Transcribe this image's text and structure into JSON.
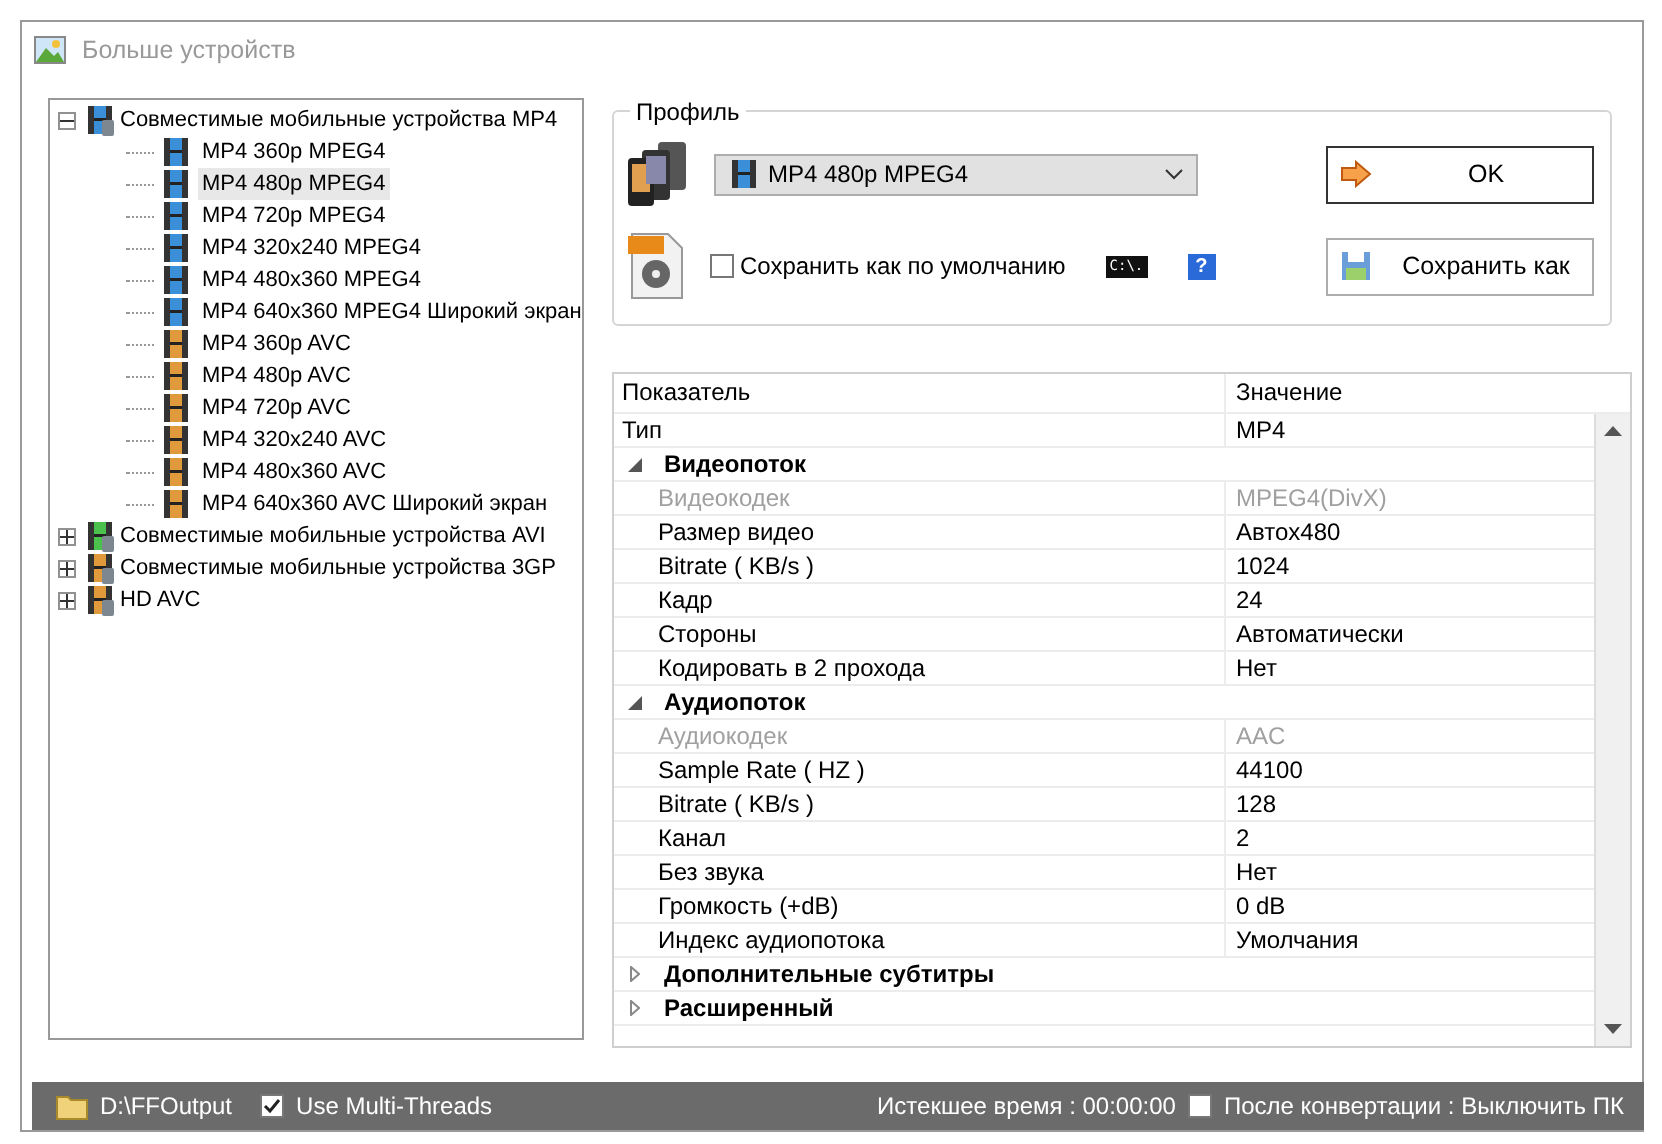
{
  "window": {
    "title": "Больше устройств"
  },
  "tree": [
    {
      "label": "Совместимые мобильные устройства MP4",
      "expanded": true,
      "color": "#3a8fd8",
      "selected": false,
      "children": [
        {
          "label": "MP4 360p MPEG4",
          "color": "#3a8fd8",
          "selected": false
        },
        {
          "label": "MP4 480p MPEG4",
          "color": "#3a8fd8",
          "selected": true
        },
        {
          "label": "MP4 720p MPEG4",
          "color": "#3a8fd8",
          "selected": false
        },
        {
          "label": "MP4 320x240 MPEG4",
          "color": "#3a8fd8",
          "selected": false
        },
        {
          "label": "MP4 480x360 MPEG4",
          "color": "#3a8fd8",
          "selected": false
        },
        {
          "label": "MP4 640x360 MPEG4 Широкий экран",
          "color": "#3a8fd8",
          "selected": false
        },
        {
          "label": "MP4 360p AVC",
          "color": "#e09a3c",
          "selected": false
        },
        {
          "label": "MP4 480p AVC",
          "color": "#e09a3c",
          "selected": false
        },
        {
          "label": "MP4 720p AVC",
          "color": "#e09a3c",
          "selected": false
        },
        {
          "label": "MP4 320x240 AVC",
          "color": "#e09a3c",
          "selected": false
        },
        {
          "label": "MP4 480x360 AVC",
          "color": "#e09a3c",
          "selected": false
        },
        {
          "label": "MP4 640x360 AVC Широкий экран",
          "color": "#e09a3c",
          "selected": false
        }
      ]
    },
    {
      "label": "Совместимые мобильные устройства AVI",
      "expanded": false,
      "color": "#4cc04c",
      "selected": false
    },
    {
      "label": "Совместимые мобильные устройства 3GP",
      "expanded": false,
      "color": "#e09a3c",
      "selected": false
    },
    {
      "label": "HD AVC",
      "expanded": false,
      "color": "#e09a3c",
      "selected": false
    }
  ],
  "profile": {
    "label": "Профиль",
    "format_value": "MP4 480p MPEG4",
    "save_default": {
      "label": "Сохранить как по умолчанию",
      "checked": false
    },
    "console_button": "C:\\.",
    "help_button": "?",
    "ok_button": "OK",
    "save_as_button": "Сохранить как"
  },
  "property_grid": {
    "columns": [
      "Показатель",
      "Значение"
    ],
    "top_row": {
      "name": "Тип",
      "value": "MP4",
      "disabled": false
    },
    "rows": [
      {
        "kind": "group",
        "name": "Видеопоток",
        "expanded": true,
        "children": [
          {
            "name": "Видеокодек",
            "value": "MPEG4(DivX)",
            "disabled": true
          },
          {
            "name": "Размер видео",
            "value": "Автоx480",
            "disabled": false
          },
          {
            "name": "Bitrate ( KB/s )",
            "value": "1024",
            "disabled": false
          },
          {
            "name": "Кадр",
            "value": "24",
            "disabled": false
          },
          {
            "name": "Стороны",
            "value": "Автоматически",
            "disabled": false
          },
          {
            "name": "Кодировать в 2 прохода",
            "value": "Нет",
            "disabled": false
          }
        ]
      },
      {
        "kind": "group",
        "name": "Аудиопоток",
        "expanded": true,
        "children": [
          {
            "name": "Аудиокодек",
            "value": "AAC",
            "disabled": true
          },
          {
            "name": "Sample Rate ( HZ )",
            "value": "44100",
            "disabled": false
          },
          {
            "name": "Bitrate ( KB/s )",
            "value": "128",
            "disabled": false
          },
          {
            "name": "Канал",
            "value": "2",
            "disabled": false
          },
          {
            "name": "Без звука",
            "value": "Нет",
            "disabled": false
          },
          {
            "name": "Громкость (+dB)",
            "value": "0 dB",
            "disabled": false
          },
          {
            "name": "Индекс аудиопотока",
            "value": "Умолчания",
            "disabled": false
          }
        ]
      },
      {
        "kind": "group",
        "name": "Дополнительные субтитры",
        "expanded": false
      },
      {
        "kind": "group",
        "name": "Расширенный",
        "expanded": false
      }
    ]
  },
  "status_bar": {
    "output_folder": "D:\\FFOutput",
    "multi_threads": {
      "label": "Use Multi-Threads",
      "checked": true
    },
    "elapsed": "Истекшее время : 00:00:00",
    "shutdown": {
      "label": "После конвертации : Выключить ПК",
      "checked": false
    }
  }
}
